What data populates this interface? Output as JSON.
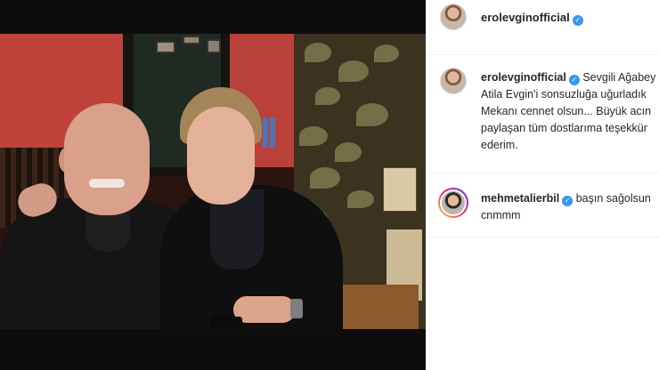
{
  "post": {
    "author": {
      "username": "erolevginofficial",
      "verified": true
    },
    "image_alt": "Two men seated at a restaurant table"
  },
  "caption": {
    "username": "erolevginofficial",
    "lines": [
      "Sevgili Ağabey",
      "Atila Evgin'i sonsuzluğa uğurladık",
      "Mekanı cennet olsun... Büyük acın",
      "paylaşan tüm dostlarıma teşekkür",
      "ederim."
    ]
  },
  "comments": [
    {
      "username": "mehmetalierbil",
      "verified": true,
      "lines": [
        "başın sağolsun",
        "cnmmm"
      ]
    }
  ],
  "colors": {
    "verified_badge": "#3897f0",
    "text": "#262626",
    "photo_background": "#0d0d0d"
  }
}
